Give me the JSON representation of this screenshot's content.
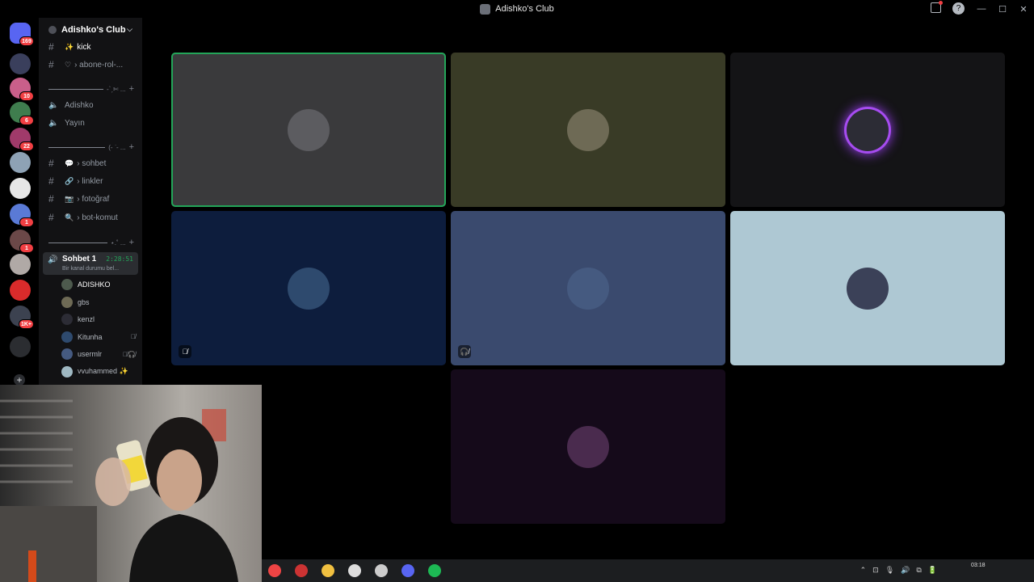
{
  "window": {
    "title": "Adishko's Club",
    "controls": [
      "—",
      "☐",
      "✕"
    ]
  },
  "guilds": {
    "items": [
      {
        "name": "direct-messages",
        "color": "#5865f2",
        "badge": "169"
      },
      {
        "name": "server-1",
        "color": "#3a3f5c",
        "badge": ""
      },
      {
        "name": "server-2",
        "color": "#c95f8a",
        "badge": "10"
      },
      {
        "name": "server-3",
        "color": "#3f7d4e",
        "badge": "6"
      },
      {
        "name": "server-4",
        "color": "#a03a6a",
        "badge": "22"
      },
      {
        "name": "server-5",
        "color": "#8ea2b5",
        "badge": ""
      },
      {
        "name": "server-6",
        "color": "#e6e6e6",
        "badge": ""
      },
      {
        "name": "server-7",
        "color": "#5a7ad6",
        "badge": "1"
      },
      {
        "name": "server-8",
        "color": "#6b4848",
        "badge": "1"
      },
      {
        "name": "server-9",
        "color": "#b0a9a6",
        "badge": ""
      },
      {
        "name": "server-10",
        "color": "#d92b2b",
        "badge": ""
      },
      {
        "name": "server-11",
        "color": "#3c4250",
        "badge": "1K+"
      },
      {
        "name": "server-12",
        "color": "#2b2d31",
        "badge": ""
      }
    ]
  },
  "server": {
    "name": "Adishko's Club"
  },
  "channels": {
    "text_top": [
      {
        "emoji": "✨",
        "label": "kick"
      },
      {
        "emoji": "♡",
        "label": "› abone-rol-..."
      }
    ],
    "cat1": {
      "label": "-ˋˏ✄ ..."
    },
    "voice_top": [
      {
        "label": "Adishko"
      },
      {
        "label": "Yayın"
      }
    ],
    "cat2": {
      "label": "(- ͘ - ..."
    },
    "text_mid": [
      {
        "emoji": "💬",
        "label": "› sohbet"
      },
      {
        "emoji": "🔗",
        "label": "› linkler"
      },
      {
        "emoji": "📷",
        "label": "› fotoğraf"
      },
      {
        "emoji": "🔍",
        "label": "› bot-komut"
      }
    ],
    "cat3": {
      "label": "⋆.˚ ..."
    },
    "voice_active": {
      "name": "Sohbet 1",
      "time": "2:28:51",
      "status": "Bir kanal durumu bel..."
    },
    "voice_users": [
      {
        "name": "ADISHKO",
        "color": "#4d5a4d",
        "icons": ""
      },
      {
        "name": "gbs",
        "color": "#6e6a55",
        "icons": ""
      },
      {
        "name": "kenzl",
        "color": "#2c2c35",
        "icons": ""
      },
      {
        "name": "Kitunha",
        "color": "#2e4a6e",
        "icons": "🎙̸"
      },
      {
        "name": "usermlr",
        "color": "#455a80",
        "icons": "🎙̸🎧̸"
      },
      {
        "name": "vvuhammed ✨",
        "color": "#9fb8c2",
        "icons": ""
      }
    ]
  },
  "tiles": [
    {
      "bg": "#3a3a3c",
      "avatar": "#5c5c60",
      "speaking": true,
      "ring": false,
      "mic": ""
    },
    {
      "bg": "#393b26",
      "avatar": "#6e6a55",
      "speaking": false,
      "ring": false,
      "mic": ""
    },
    {
      "bg": "#141416",
      "avatar": "#2c2c35",
      "speaking": false,
      "ring": true,
      "mic": ""
    },
    {
      "bg": "#0d1d3d",
      "avatar": "#2e4a6e",
      "speaking": false,
      "ring": false,
      "mic": "🎙̸"
    },
    {
      "bg": "#3a4a6e",
      "avatar": "#455a80",
      "speaking": false,
      "ring": false,
      "mic": "🎧̸"
    },
    {
      "bg": "#aec8d3",
      "avatar": "#3b4158",
      "speaking": false,
      "ring": false,
      "mic": ""
    },
    {
      "bg": "#150a1a",
      "avatar": "#4a2b4e",
      "speaking": false,
      "ring": false,
      "mic": ""
    }
  ],
  "taskbar": {
    "apps": [
      "#e44",
      "#c33",
      "#f0c040",
      "#ddd",
      "#ccc",
      "#5865f2",
      "#1db954"
    ],
    "tray": [
      "⌃",
      "⊡",
      "🎙",
      "🔊",
      "⧉",
      "🔋"
    ],
    "clock": "03:18"
  }
}
